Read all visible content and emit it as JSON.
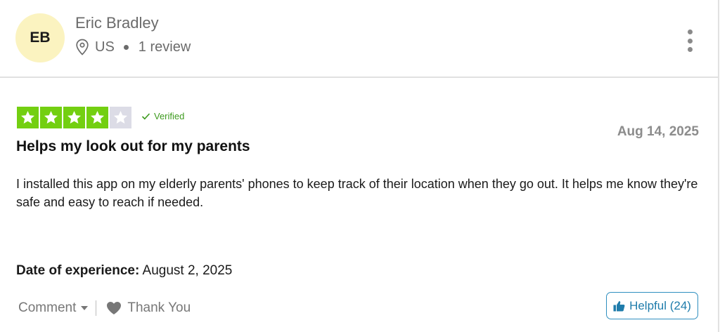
{
  "reviewer": {
    "initials": "EB",
    "name": "Eric Bradley",
    "country": "US",
    "review_count": "1 review"
  },
  "review": {
    "rating": 4,
    "max_rating": 5,
    "verified_label": "Verified",
    "date": "Aug 14, 2025",
    "title": "Helps my look out for my parents",
    "body": "I installed this app on my elderly parents' phones to keep track of their location when they go out. It helps me know they're safe and easy to reach if needed.",
    "experience_label": "Date of experience:",
    "experience_date": "August 2, 2025"
  },
  "actions": {
    "comment_label": "Comment",
    "thank_label": "Thank You",
    "helpful_label": "Helpful (24)"
  },
  "icons": {
    "location": "map-pin-icon",
    "more": "vertical-dots-icon",
    "star": "star-icon",
    "verified": "checkmark-icon",
    "caret": "caret-down-icon",
    "heart": "heart-icon",
    "thumb": "thumbs-up-icon"
  },
  "colors": {
    "star_filled": "#73cf11",
    "star_empty": "#dcdce6",
    "avatar_bg": "#fbf3c0",
    "verified": "#3e9b1f",
    "helpful_border": "#2f8fbf"
  }
}
